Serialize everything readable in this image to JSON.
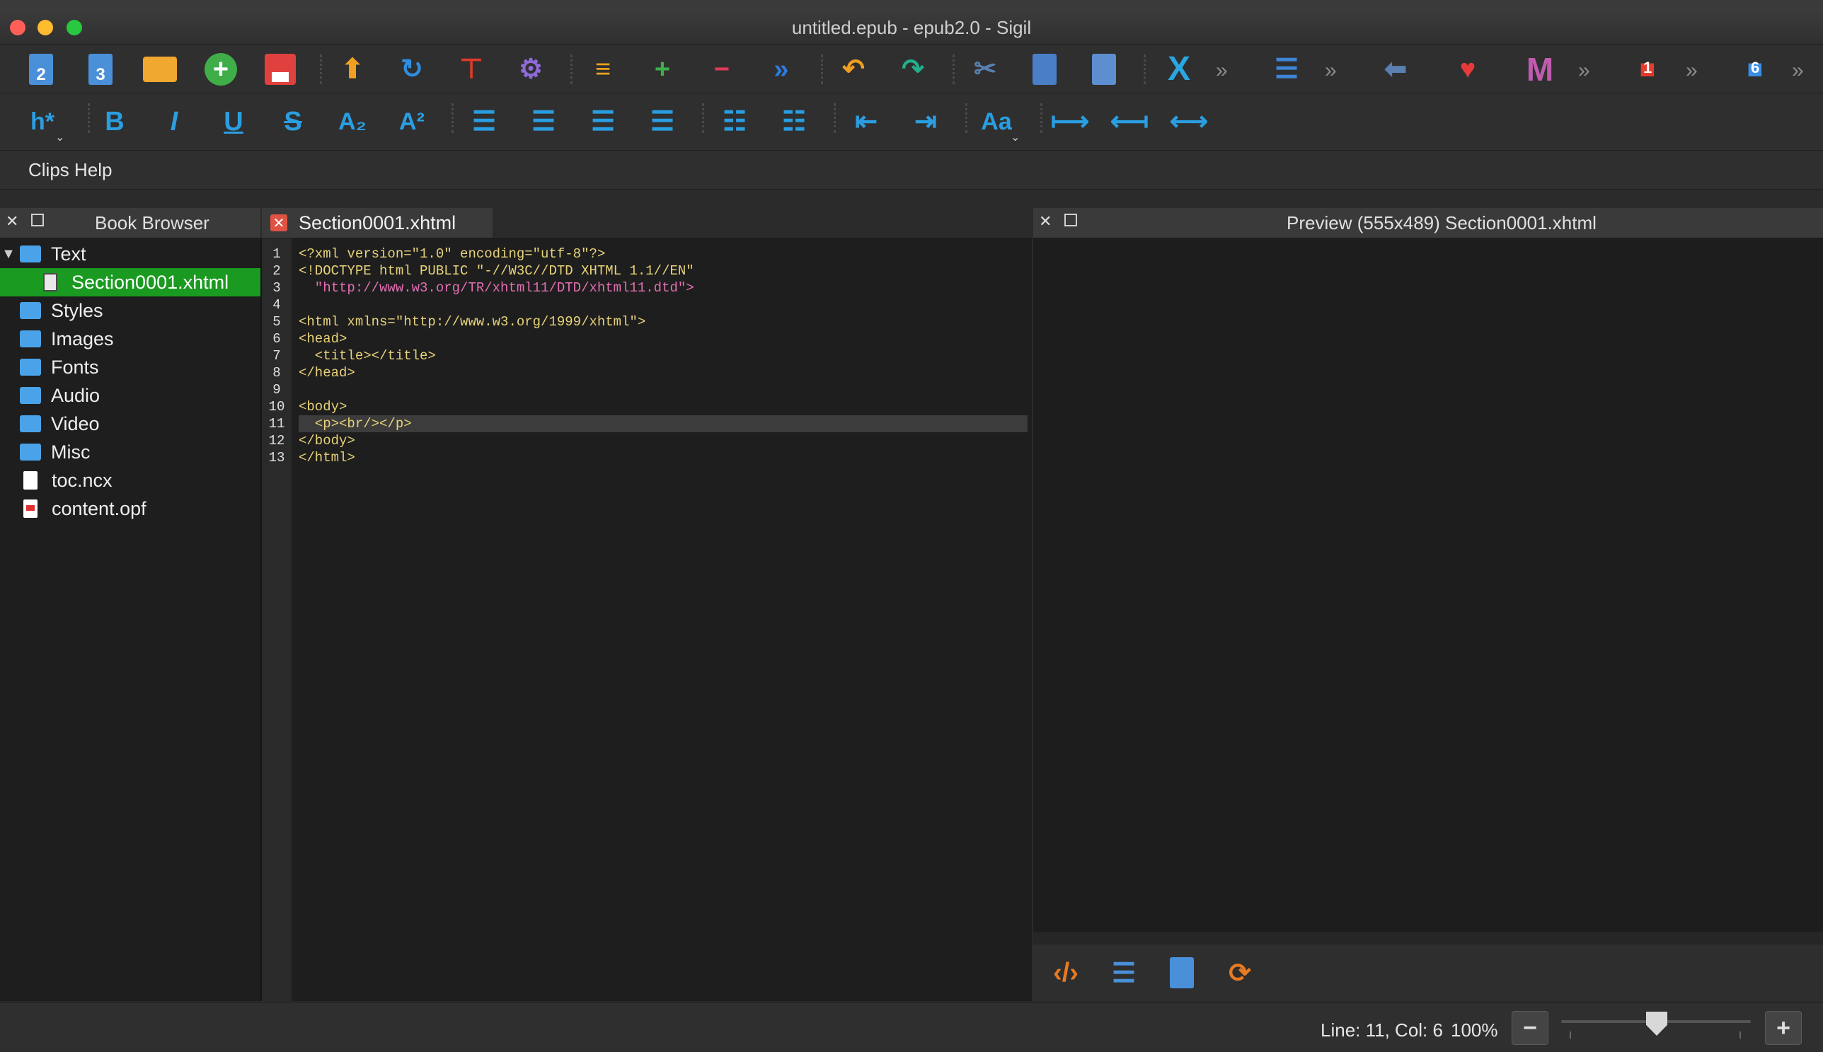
{
  "window": {
    "title": "untitled.epub - epub2.0 - Sigil"
  },
  "toolbar_main": {
    "buttons": [
      {
        "name": "new-epub2-icon",
        "label": "2"
      },
      {
        "name": "new-epub3-icon",
        "label": "3"
      },
      {
        "name": "open-folder-icon"
      },
      {
        "name": "add-file-icon",
        "label": "+"
      },
      {
        "name": "save-icon"
      },
      {
        "name": "upload-arrow-icon"
      },
      {
        "name": "reload-icon"
      },
      {
        "name": "insert-file-icon"
      },
      {
        "name": "settings-gear-icon"
      },
      {
        "name": "merge-icon"
      },
      {
        "name": "add-toc-icon"
      },
      {
        "name": "remove-icon"
      },
      {
        "name": "forward-icon"
      },
      {
        "name": "undo-icon"
      },
      {
        "name": "redo-icon"
      },
      {
        "name": "cut-icon"
      },
      {
        "name": "copy-icon"
      },
      {
        "name": "paste-icon"
      },
      {
        "name": "x-plugin-icon"
      },
      {
        "name": "split-icon"
      },
      {
        "name": "back-arrow-icon"
      },
      {
        "name": "heart-icon"
      },
      {
        "name": "m-plugin-icon"
      },
      {
        "name": "puzzle-red-icon",
        "badge": "1"
      },
      {
        "name": "puzzle-blue-icon",
        "badge": "6"
      }
    ],
    "overflow_glyph": "»"
  },
  "toolbar_format": {
    "heading_label": "h*",
    "bold": "B",
    "italic": "I",
    "underline": "U",
    "strike": "S",
    "subscript": "A₂",
    "superscript": "A²",
    "case_label": "Aa"
  },
  "clips": {
    "label": "Clips Help"
  },
  "book_browser": {
    "title": "Book Browser",
    "items": [
      {
        "label": "Text",
        "type": "folder",
        "expanded": true
      },
      {
        "label": "Section0001.xhtml",
        "type": "xhtml",
        "selected": true
      },
      {
        "label": "Styles",
        "type": "folder"
      },
      {
        "label": "Images",
        "type": "folder"
      },
      {
        "label": "Fonts",
        "type": "folder"
      },
      {
        "label": "Audio",
        "type": "folder"
      },
      {
        "label": "Video",
        "type": "folder"
      },
      {
        "label": "Misc",
        "type": "folder"
      },
      {
        "label": "toc.ncx",
        "type": "file"
      },
      {
        "label": "content.opf",
        "type": "opf"
      }
    ]
  },
  "editor": {
    "tab_label": "Section0001.xhtml",
    "active_line": 11,
    "lines": [
      "<?xml version=\"1.0\" encoding=\"utf-8\"?>",
      "<!DOCTYPE html PUBLIC \"-//W3C//DTD XHTML 1.1//EN\"",
      "  \"http://www.w3.org/TR/xhtml11/DTD/xhtml11.dtd\">",
      "",
      "<html xmlns=\"http://www.w3.org/1999/xhtml\">",
      "<head>",
      "  <title></title>",
      "</head>",
      "",
      "<body>",
      "  <p><br/></p>",
      "</body>",
      "</html>"
    ]
  },
  "preview": {
    "title": "Preview (555x489) Section0001.xhtml"
  },
  "status": {
    "position": "Line: 11, Col: 6",
    "zoom": "100%",
    "zoom_minus": "−",
    "zoom_plus": "+"
  },
  "colors": {
    "accent_green": "#1a9a20",
    "folder_blue": "#4aa3e8",
    "icon_blue": "#4a90d9",
    "icon_orange": "#f0a830"
  }
}
